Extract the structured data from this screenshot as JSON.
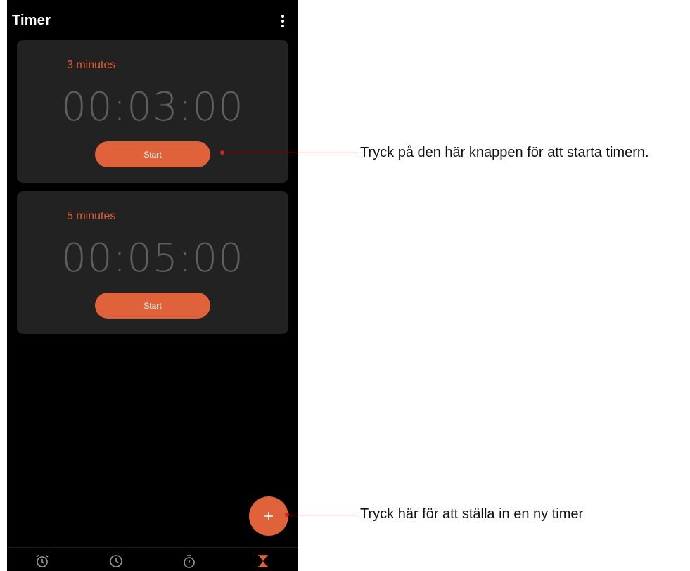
{
  "app_bar": {
    "title": "Timer",
    "menu_icon": "more-vert-icon"
  },
  "timers": [
    {
      "label": "3 minutes",
      "time": "00:03:00",
      "start_label": "Start"
    },
    {
      "label": "5 minutes",
      "time": "00:05:00",
      "start_label": "Start"
    }
  ],
  "fab": {
    "icon": "plus-icon",
    "label": "+"
  },
  "bottom_nav": [
    {
      "name": "Alarm",
      "icon": "alarm-icon",
      "active": false
    },
    {
      "name": "Clock",
      "icon": "clock-icon",
      "active": false
    },
    {
      "name": "Stopwatch",
      "icon": "stopwatch-icon",
      "active": false
    },
    {
      "name": "Timer",
      "icon": "hourglass-icon",
      "active": true
    }
  ],
  "annotations": [
    {
      "text": "Tryck på den här knappen för att starta timern."
    },
    {
      "text": "Tryck här för att ställa in en ny timer"
    }
  ],
  "colors": {
    "accent": "#e0623a",
    "background": "#000000",
    "card": "#222222",
    "annotation_line": "#d5202b"
  }
}
